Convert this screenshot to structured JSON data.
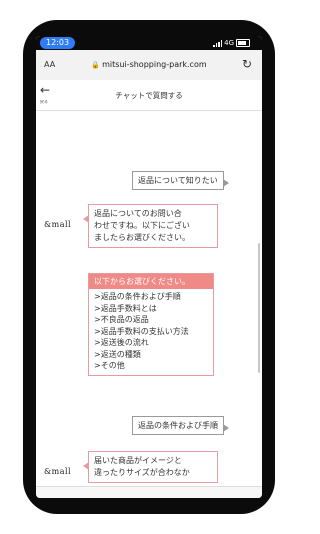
{
  "status": {
    "time": "12:03",
    "network": "4G"
  },
  "browser": {
    "text_size_label": "AA",
    "url": "mitsui-shopping-park.com",
    "reload_icon": "reload-icon"
  },
  "header": {
    "back_label": "戻る",
    "title": "チャットで質問する"
  },
  "chat": {
    "brand_logo": "&mall",
    "user_msg_1": "返品について知りたい",
    "bot_msg_1": [
      "返品についてのお問い合",
      "わせですね。以下にござい",
      "ましたらお選びください。"
    ],
    "options_header": "以下からお選びください。",
    "options": [
      ">返品の条件および手順",
      ">返品手数料とは",
      ">不良品の返品",
      ">返品手数料の支払い方法",
      ">返送後の流れ",
      ">返送の種類",
      ">その他"
    ],
    "user_msg_2": "返品の条件および手順",
    "bot_msg_2": [
      "届いた商品がイメージと",
      "違ったりサイズが合わなか"
    ]
  },
  "colors": {
    "accent": "#2e7cf6",
    "bot_border": "#e79a9f",
    "options_header_bg": "#f08a86"
  }
}
